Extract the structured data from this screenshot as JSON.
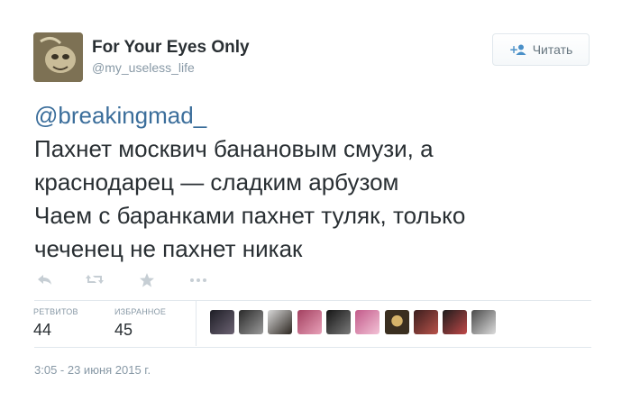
{
  "author": {
    "fullname": "For Your Eyes Only",
    "username": "@my_useless_life",
    "avatar_icon": "user-avatar"
  },
  "follow_button": {
    "label": "Читать",
    "icon": "follow-user-icon"
  },
  "tweet": {
    "mention_at": "@",
    "mention_name": "breakingmad_",
    "lines": [
      "Пахнет москвич банановым смузи, а",
      "краснодарец — сладким арбузом",
      "Чаем с баранками пахнет туляк, только",
      "чеченец не пахнет никак"
    ]
  },
  "actions": {
    "reply_icon": "reply-icon",
    "retweet_icon": "retweet-icon",
    "favorite_icon": "star-icon",
    "more_icon": "more-icon"
  },
  "stats": {
    "retweets_label": "РЕТВИТОВ",
    "retweets_value": "44",
    "favorites_label": "ИЗБРАННОЕ",
    "favorites_value": "45"
  },
  "favorited_by_count": 10,
  "timestamp": "3:05 - 23 июня 2015 г.",
  "colors": {
    "link": "#3b6e9b",
    "muted": "#8899a6",
    "text": "#292f33",
    "border": "#e1e8ed"
  }
}
